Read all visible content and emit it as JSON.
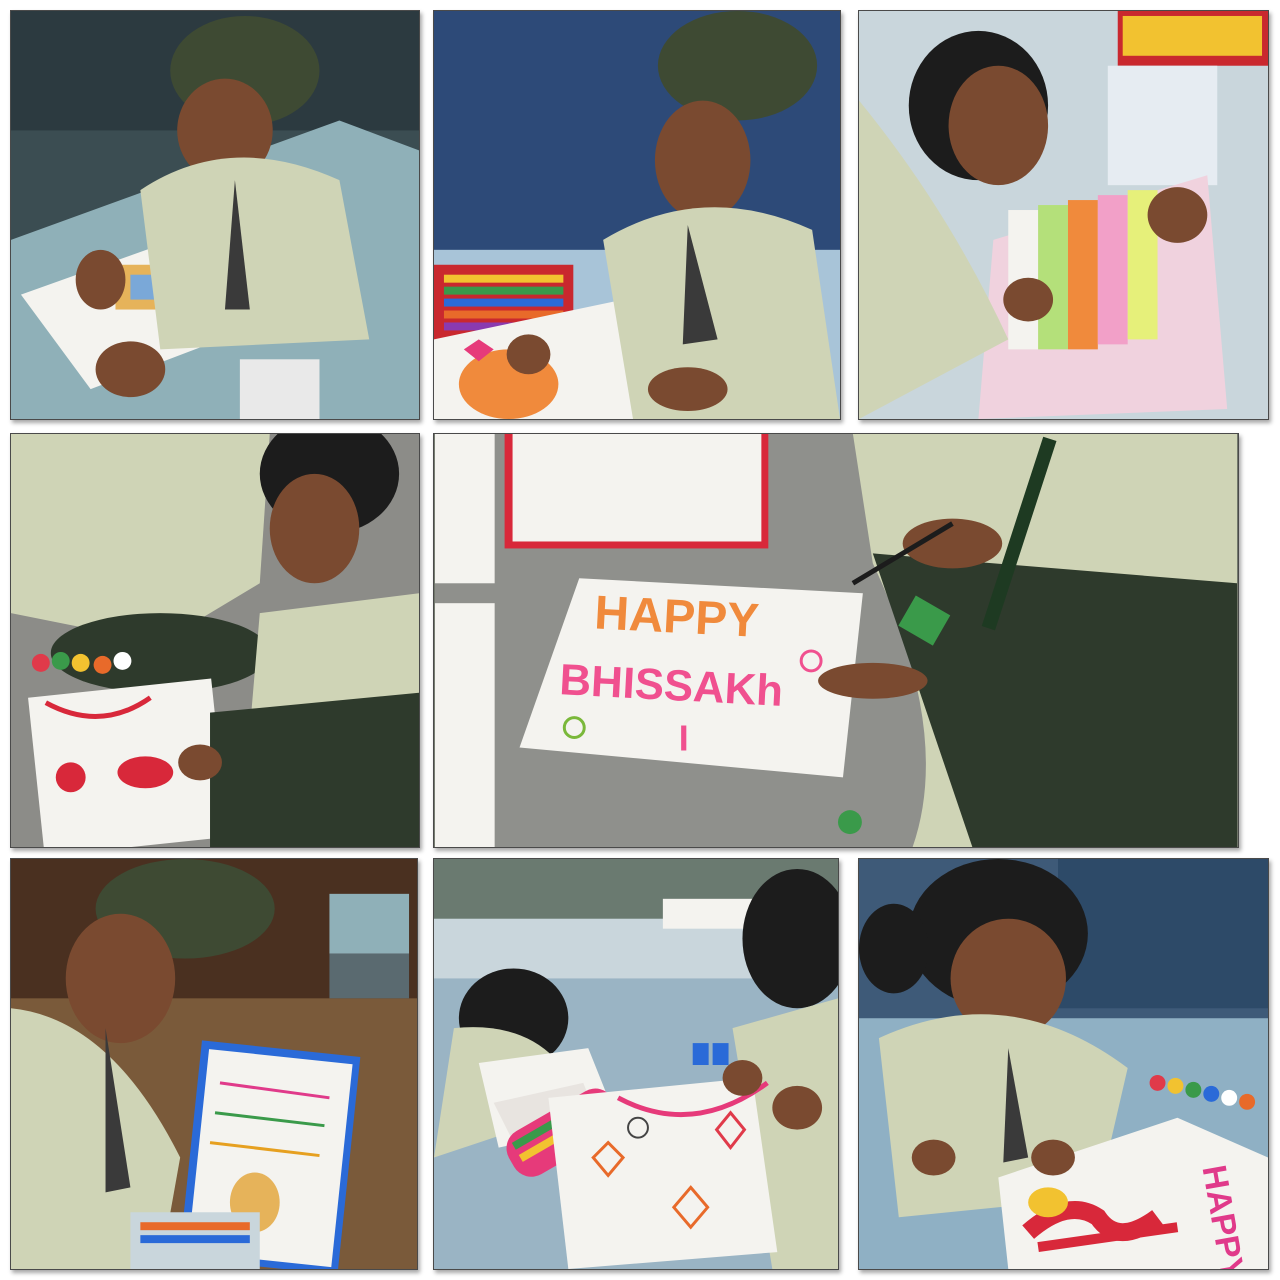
{
  "collage": {
    "photos": [
      {
        "name": "boy-turban-drawing"
      },
      {
        "name": "boy-coloring-with-crayons"
      },
      {
        "name": "girl-coloring-striped-chart"
      },
      {
        "name": "girl-painting-on-floor"
      },
      {
        "name": "student-painting-happy-bhissakhi-sign"
      },
      {
        "name": "boy-turban-writing-poster"
      },
      {
        "name": "girls-drawing-kites"
      },
      {
        "name": "girl-painting-happy-letters"
      }
    ]
  },
  "poster": {
    "line1": "HAPPY",
    "line2": "BHISSAKh",
    "line3": "I"
  },
  "corner_poster": {
    "text": "HAPPY"
  },
  "colors": {
    "uniform_check": "#cfd4b6",
    "turban": "#3e4a33",
    "paper": "#f4f3ef",
    "orange_paint": "#f08a3c",
    "pink_paint": "#f0508f",
    "red_paint": "#d8283a"
  }
}
